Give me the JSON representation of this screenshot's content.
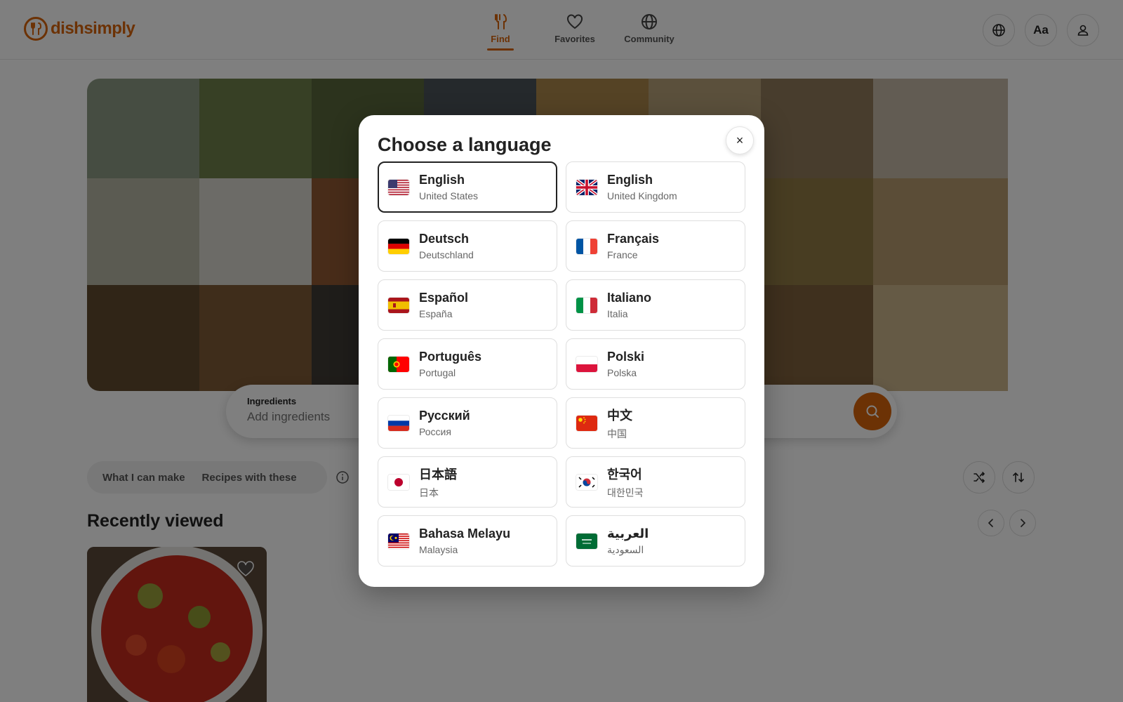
{
  "brand": {
    "name": "dishsimply",
    "color": "#d9640a"
  },
  "nav": {
    "items": [
      {
        "label": "Find",
        "icon": "fork-knife-icon",
        "active": true
      },
      {
        "label": "Favorites",
        "icon": "heart-icon",
        "active": false
      },
      {
        "label": "Community",
        "icon": "globe-icon",
        "active": false
      }
    ]
  },
  "header_actions": {
    "language_icon": "globe-icon",
    "font_label": "Aa",
    "account_icon": "user-icon"
  },
  "search": {
    "label": "Ingredients",
    "placeholder": "Add ingredients",
    "button_icon": "search-icon"
  },
  "filters": {
    "options": [
      "What I can make",
      "Recipes with these"
    ],
    "info_icon": "info-icon"
  },
  "sort_actions": {
    "shuffle_icon": "shuffle-icon",
    "sort_icon": "sort-icon"
  },
  "recent": {
    "title": "Recently viewed",
    "prev_icon": "chevron-left-icon",
    "next_icon": "chevron-right-icon"
  },
  "modal": {
    "title": "Choose a language",
    "close_label": "×",
    "languages": [
      {
        "name": "English",
        "region": "United States",
        "flag": "us",
        "selected": true
      },
      {
        "name": "English",
        "region": "United Kingdom",
        "flag": "gb",
        "selected": false
      },
      {
        "name": "Deutsch",
        "region": "Deutschland",
        "flag": "de",
        "selected": false
      },
      {
        "name": "Français",
        "region": "France",
        "flag": "fr",
        "selected": false
      },
      {
        "name": "Español",
        "region": "España",
        "flag": "es",
        "selected": false
      },
      {
        "name": "Italiano",
        "region": "Italia",
        "flag": "it",
        "selected": false
      },
      {
        "name": "Português",
        "region": "Portugal",
        "flag": "pt",
        "selected": false
      },
      {
        "name": "Polski",
        "region": "Polska",
        "flag": "pl",
        "selected": false
      },
      {
        "name": "Русский",
        "region": "Россия",
        "flag": "ru",
        "selected": false
      },
      {
        "name": "中文",
        "region": "中国",
        "flag": "cn",
        "selected": false
      },
      {
        "name": "日本語",
        "region": "日本",
        "flag": "jp",
        "selected": false
      },
      {
        "name": "한국어",
        "region": "대한민국",
        "flag": "kr",
        "selected": false
      },
      {
        "name": "Bahasa Melayu",
        "region": "Malaysia",
        "flag": "my",
        "selected": false
      },
      {
        "name": "العربية",
        "region": "السعودية",
        "flag": "sa",
        "selected": false
      }
    ]
  }
}
